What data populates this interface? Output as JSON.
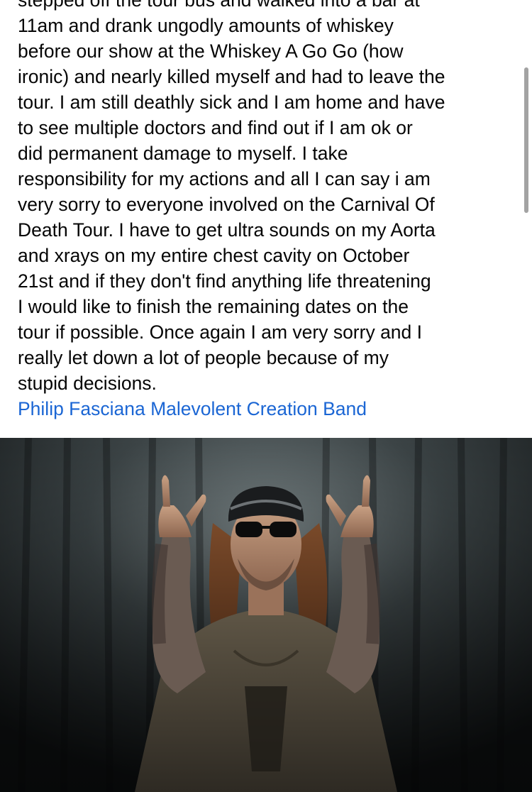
{
  "post": {
    "lines": [
      "stepped off the tour bus and walked into a bar at",
      "11am and drank ungodly amounts of whiskey",
      "before our show at the Whiskey A Go Go (how",
      "ironic) and nearly killed myself and had to leave the",
      "tour. I am still deathly sick and I am home and have",
      "to see multiple doctors and find out if I am ok or",
      "did permanent damage to myself. I take",
      "responsibility for my actions and all I can say i am",
      "very sorry to everyone involved on the Carnival Of",
      "Death Tour. I have to get ultra sounds on my Aorta",
      "and xrays on my entire chest cavity on October",
      "21st and if they don't find anything life threatening",
      "I would like to finish the remaining dates on the",
      "tour if possible. Once again I am very sorry and I",
      "really let down a lot of people because  of my",
      "stupid decisions."
    ],
    "tags": [
      "Philip Fasciana",
      "Malevolent Creation Band"
    ]
  },
  "colors": {
    "text": "#050505",
    "link": "#1b66d4",
    "background": "#ffffff"
  },
  "photo": {
    "subject": "musician-photo"
  }
}
